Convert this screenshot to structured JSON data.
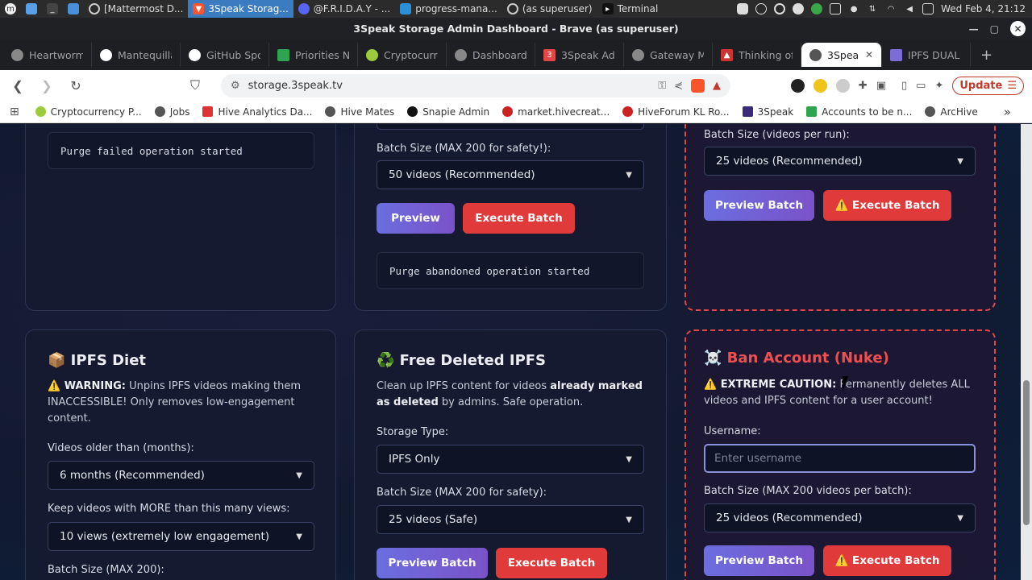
{
  "os_bar": {
    "tasks": [
      {
        "label": "[Mattermost D...",
        "icon": "mattermost-icon"
      },
      {
        "label": "3Speak Storag...",
        "icon": "brave-icon",
        "active": true
      },
      {
        "label": "@F.R.I.D.A.Y - ...",
        "icon": "discord-icon"
      },
      {
        "label": "progress-mana...",
        "icon": "vscode-icon"
      },
      {
        "label": "(as superuser)",
        "icon": "github-icon"
      },
      {
        "label": "Terminal",
        "icon": "terminal-icon"
      }
    ],
    "clock": "Wed Feb  4, 21:12"
  },
  "window": {
    "title": "3Speak Storage Admin Dashboard - Brave (as superuser)"
  },
  "tabs": [
    {
      "label": "Heartworm",
      "color": "#888"
    },
    {
      "label": "Mantequilla",
      "color": "#fff"
    },
    {
      "label": "GitHub Spo",
      "color": "#fff"
    },
    {
      "label": "Priorities N",
      "color": "#2ea44f"
    },
    {
      "label": "Cryptocurre",
      "color": "#9ccc3c"
    },
    {
      "label": "Dashboard",
      "color": "#888"
    },
    {
      "label": "3Speak Adm",
      "color": "#e04848"
    },
    {
      "label": "Gateway M",
      "color": "#888"
    },
    {
      "label": "Thinking of",
      "color": "#c33"
    },
    {
      "label": "3Speak",
      "color": "#555",
      "active": true
    },
    {
      "label": "IPFS DUAL",
      "color": "#7b6cd8"
    }
  ],
  "nav": {
    "url": "storage.3speak.tv",
    "update_label": "Update"
  },
  "bookmarks": [
    {
      "label": "Cryptocurrency P...",
      "color": "#9ccc3c"
    },
    {
      "label": "Jobs",
      "color": "#555"
    },
    {
      "label": "Hive Analytics Da...",
      "color": "#d33"
    },
    {
      "label": "Hive Mates",
      "color": "#555"
    },
    {
      "label": "Snapie Admin",
      "color": "#111"
    },
    {
      "label": "market.hivecreat...",
      "color": "#c22"
    },
    {
      "label": "HiveForum KL Ro...",
      "color": "#c22"
    },
    {
      "label": "3Speak",
      "color": "#3b2a7a"
    },
    {
      "label": "Accounts to be n...",
      "color": "#2ea44f"
    },
    {
      "label": "ArcHive",
      "color": "#555"
    }
  ],
  "top_left_card": {
    "log": "Purge failed operation started"
  },
  "top_mid_card": {
    "batch_label": "Batch Size (MAX 200 for safety!):",
    "batch_value": "50 videos (Recommended)",
    "preview_label": "Preview",
    "execute_label": "Execute Batch",
    "log": "Purge abandoned operation started"
  },
  "top_right_card": {
    "batch_label": "Batch Size (videos per run):",
    "batch_value": "25 videos (Recommended)",
    "preview_label": "Preview Batch",
    "execute_label": "⚠️ Execute Batch"
  },
  "ipfs_diet": {
    "title": "📦 IPFS Diet",
    "warning_strong": "⚠️ WARNING:",
    "warning_text": " Unpins IPFS videos making them INACCESSIBLE! Only removes low-engagement content.",
    "age_label": "Videos older than (months):",
    "age_value": "6 months (Recommended)",
    "views_label": "Keep videos with MORE than this many views:",
    "views_value": "10 views (extremely low engagement)",
    "batch_label": "Batch Size (MAX 200):"
  },
  "free_deleted": {
    "title": "♻️ Free Deleted IPFS",
    "desc_1": "Clean up IPFS content for videos ",
    "desc_2": "already marked as deleted",
    "desc_3": " by admins. Safe operation.",
    "storage_label": "Storage Type:",
    "storage_value": "IPFS Only",
    "batch_label": "Batch Size (MAX 200 for safety):",
    "batch_value": "25 videos (Safe)",
    "preview_label": "Preview Batch",
    "execute_label": "Execute Batch"
  },
  "ban_account": {
    "title": "☠️ Ban Account (Nuke)",
    "caution_strong": "⚠️ EXTREME CAUTION:",
    "caution_text": " Permanently deletes ALL videos and IPFS content for a user account!",
    "username_label": "Username:",
    "username_placeholder": "Enter username",
    "batch_label": "Batch Size (MAX 200 videos per batch):",
    "batch_value": "25 videos (Recommended)",
    "preview_label": "Preview Batch",
    "execute_label": "⚠️ Execute Batch"
  }
}
